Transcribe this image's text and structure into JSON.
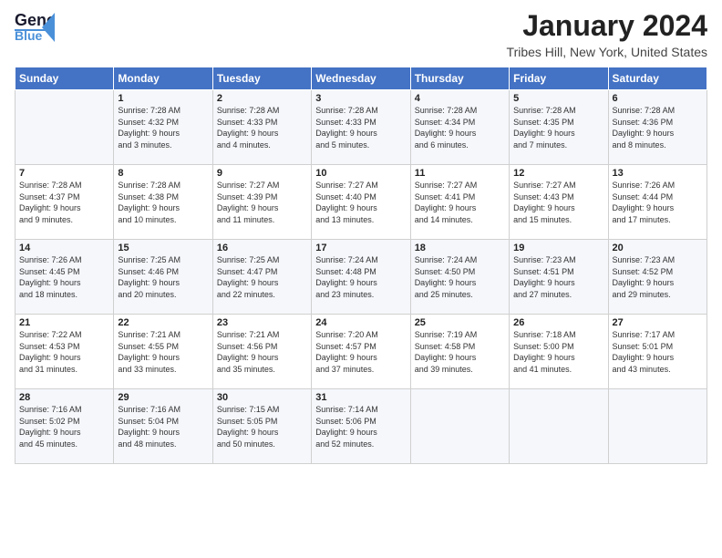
{
  "header": {
    "logo_general": "General",
    "logo_blue": "Blue",
    "month_title": "January 2024",
    "location": "Tribes Hill, New York, United States"
  },
  "days_of_week": [
    "Sunday",
    "Monday",
    "Tuesday",
    "Wednesday",
    "Thursday",
    "Friday",
    "Saturday"
  ],
  "weeks": [
    [
      {
        "day": "",
        "info": ""
      },
      {
        "day": "1",
        "info": "Sunrise: 7:28 AM\nSunset: 4:32 PM\nDaylight: 9 hours\nand 3 minutes."
      },
      {
        "day": "2",
        "info": "Sunrise: 7:28 AM\nSunset: 4:33 PM\nDaylight: 9 hours\nand 4 minutes."
      },
      {
        "day": "3",
        "info": "Sunrise: 7:28 AM\nSunset: 4:33 PM\nDaylight: 9 hours\nand 5 minutes."
      },
      {
        "day": "4",
        "info": "Sunrise: 7:28 AM\nSunset: 4:34 PM\nDaylight: 9 hours\nand 6 minutes."
      },
      {
        "day": "5",
        "info": "Sunrise: 7:28 AM\nSunset: 4:35 PM\nDaylight: 9 hours\nand 7 minutes."
      },
      {
        "day": "6",
        "info": "Sunrise: 7:28 AM\nSunset: 4:36 PM\nDaylight: 9 hours\nand 8 minutes."
      }
    ],
    [
      {
        "day": "7",
        "info": "Sunrise: 7:28 AM\nSunset: 4:37 PM\nDaylight: 9 hours\nand 9 minutes."
      },
      {
        "day": "8",
        "info": "Sunrise: 7:28 AM\nSunset: 4:38 PM\nDaylight: 9 hours\nand 10 minutes."
      },
      {
        "day": "9",
        "info": "Sunrise: 7:27 AM\nSunset: 4:39 PM\nDaylight: 9 hours\nand 11 minutes."
      },
      {
        "day": "10",
        "info": "Sunrise: 7:27 AM\nSunset: 4:40 PM\nDaylight: 9 hours\nand 13 minutes."
      },
      {
        "day": "11",
        "info": "Sunrise: 7:27 AM\nSunset: 4:41 PM\nDaylight: 9 hours\nand 14 minutes."
      },
      {
        "day": "12",
        "info": "Sunrise: 7:27 AM\nSunset: 4:43 PM\nDaylight: 9 hours\nand 15 minutes."
      },
      {
        "day": "13",
        "info": "Sunrise: 7:26 AM\nSunset: 4:44 PM\nDaylight: 9 hours\nand 17 minutes."
      }
    ],
    [
      {
        "day": "14",
        "info": "Sunrise: 7:26 AM\nSunset: 4:45 PM\nDaylight: 9 hours\nand 18 minutes."
      },
      {
        "day": "15",
        "info": "Sunrise: 7:25 AM\nSunset: 4:46 PM\nDaylight: 9 hours\nand 20 minutes."
      },
      {
        "day": "16",
        "info": "Sunrise: 7:25 AM\nSunset: 4:47 PM\nDaylight: 9 hours\nand 22 minutes."
      },
      {
        "day": "17",
        "info": "Sunrise: 7:24 AM\nSunset: 4:48 PM\nDaylight: 9 hours\nand 23 minutes."
      },
      {
        "day": "18",
        "info": "Sunrise: 7:24 AM\nSunset: 4:50 PM\nDaylight: 9 hours\nand 25 minutes."
      },
      {
        "day": "19",
        "info": "Sunrise: 7:23 AM\nSunset: 4:51 PM\nDaylight: 9 hours\nand 27 minutes."
      },
      {
        "day": "20",
        "info": "Sunrise: 7:23 AM\nSunset: 4:52 PM\nDaylight: 9 hours\nand 29 minutes."
      }
    ],
    [
      {
        "day": "21",
        "info": "Sunrise: 7:22 AM\nSunset: 4:53 PM\nDaylight: 9 hours\nand 31 minutes."
      },
      {
        "day": "22",
        "info": "Sunrise: 7:21 AM\nSunset: 4:55 PM\nDaylight: 9 hours\nand 33 minutes."
      },
      {
        "day": "23",
        "info": "Sunrise: 7:21 AM\nSunset: 4:56 PM\nDaylight: 9 hours\nand 35 minutes."
      },
      {
        "day": "24",
        "info": "Sunrise: 7:20 AM\nSunset: 4:57 PM\nDaylight: 9 hours\nand 37 minutes."
      },
      {
        "day": "25",
        "info": "Sunrise: 7:19 AM\nSunset: 4:58 PM\nDaylight: 9 hours\nand 39 minutes."
      },
      {
        "day": "26",
        "info": "Sunrise: 7:18 AM\nSunset: 5:00 PM\nDaylight: 9 hours\nand 41 minutes."
      },
      {
        "day": "27",
        "info": "Sunrise: 7:17 AM\nSunset: 5:01 PM\nDaylight: 9 hours\nand 43 minutes."
      }
    ],
    [
      {
        "day": "28",
        "info": "Sunrise: 7:16 AM\nSunset: 5:02 PM\nDaylight: 9 hours\nand 45 minutes."
      },
      {
        "day": "29",
        "info": "Sunrise: 7:16 AM\nSunset: 5:04 PM\nDaylight: 9 hours\nand 48 minutes."
      },
      {
        "day": "30",
        "info": "Sunrise: 7:15 AM\nSunset: 5:05 PM\nDaylight: 9 hours\nand 50 minutes."
      },
      {
        "day": "31",
        "info": "Sunrise: 7:14 AM\nSunset: 5:06 PM\nDaylight: 9 hours\nand 52 minutes."
      },
      {
        "day": "",
        "info": ""
      },
      {
        "day": "",
        "info": ""
      },
      {
        "day": "",
        "info": ""
      }
    ]
  ]
}
